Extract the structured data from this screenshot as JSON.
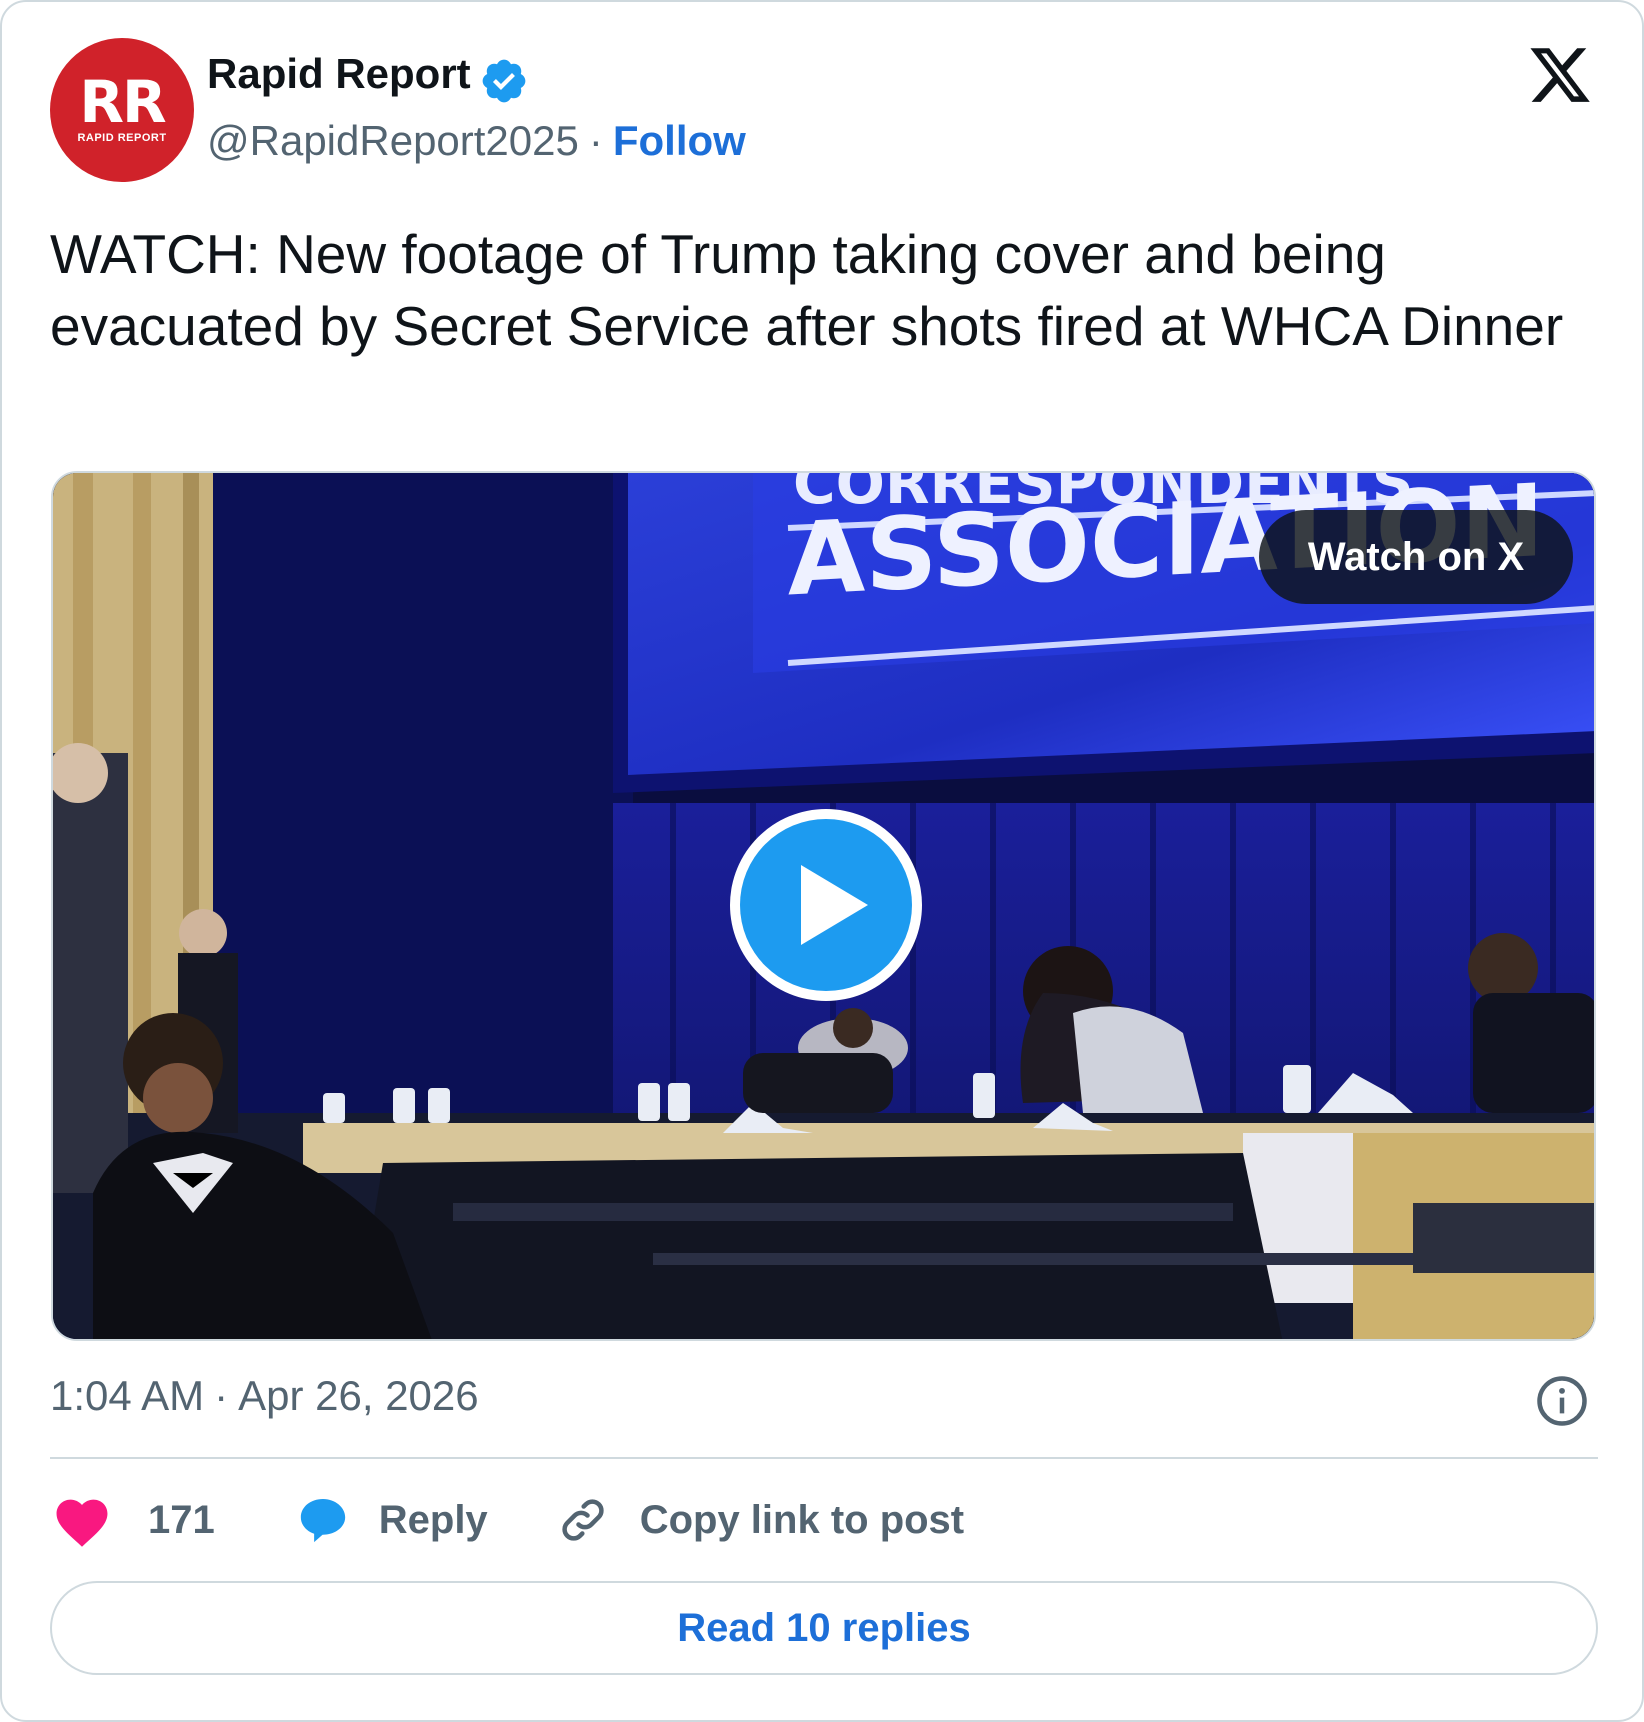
{
  "author": {
    "avatar_monogram": "RR",
    "avatar_subtitle": "RAPID REPORT",
    "name": "Rapid Report",
    "verified_icon": "verified-badge-icon",
    "handle": "@RapidReport2025",
    "separator": "·",
    "follow_label": "Follow"
  },
  "post": {
    "text": "WATCH: New footage of Trump taking cover and being evacuated by Secret Service after shots fired at WHCA Dinner"
  },
  "media": {
    "screen_text_top": "CORRESPONDENTS",
    "screen_text_main": "ASSOCIATION",
    "watch_label": "Watch on X",
    "play_icon": "play-icon"
  },
  "meta": {
    "time": "1:04 AM",
    "separator": "·",
    "date": "Apr 26, 2026",
    "info_icon": "info-icon"
  },
  "actions": {
    "like_count": "171",
    "reply_label": "Reply",
    "copy_label": "Copy link to post"
  },
  "footer": {
    "read_replies_label": "Read 10 replies"
  },
  "colors": {
    "brand_red": "#d0222a",
    "link_blue": "#1d6fd8",
    "verified_blue": "#1d9bf0",
    "like_pink": "#f91880",
    "text_primary": "#0f1419",
    "text_secondary": "#536471"
  }
}
